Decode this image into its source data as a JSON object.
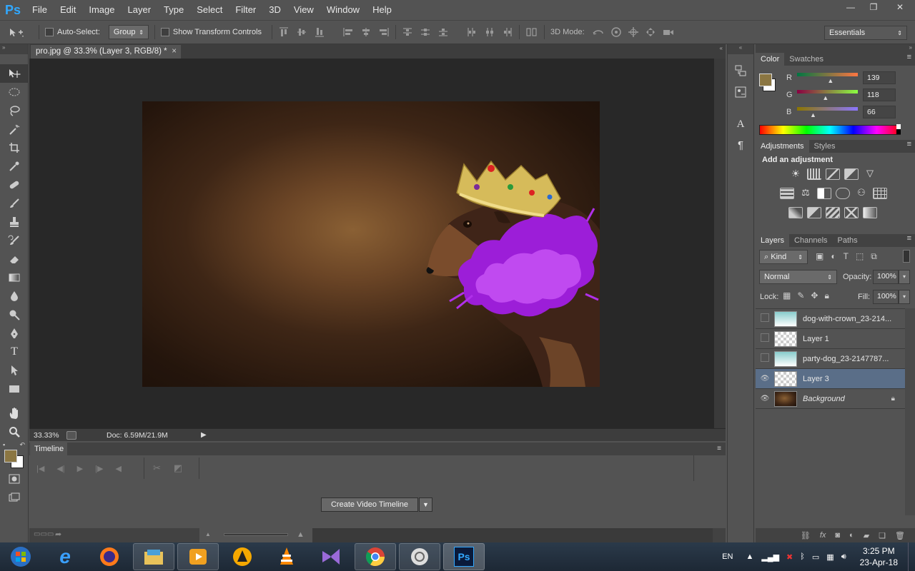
{
  "app": {
    "logo": "Ps"
  },
  "menu": [
    "File",
    "Edit",
    "Image",
    "Layer",
    "Type",
    "Select",
    "Filter",
    "3D",
    "View",
    "Window",
    "Help"
  ],
  "window_controls": {
    "minimize": "—",
    "restore": "❐",
    "close": "✕"
  },
  "options_bar": {
    "auto_select_label": "Auto-Select:",
    "auto_select_checked": false,
    "auto_select_target": "Group",
    "show_transform_label": "Show Transform Controls",
    "show_transform_checked": false,
    "mode_3d_label": "3D Mode:",
    "workspace": "Essentials"
  },
  "document": {
    "tab_title": "pro.jpg @ 33.3% (Layer 3, RGB/8) *",
    "tab_close": "×",
    "zoom": "33.33%",
    "doc_info": "Doc: 6.59M/21.9M"
  },
  "timeline": {
    "tab": "Timeline",
    "create_button": "Create Video Timeline"
  },
  "color_panel": {
    "tabs": [
      "Color",
      "Swatches"
    ],
    "foreground_color": "#8b7642",
    "channels": [
      {
        "label": "R",
        "value": "139",
        "fraction": 0.545
      },
      {
        "label": "G",
        "value": "118",
        "fraction": 0.463
      },
      {
        "label": "B",
        "value": "66",
        "fraction": 0.259
      }
    ]
  },
  "adjustments_panel": {
    "tabs": [
      "Adjustments",
      "Styles"
    ],
    "heading": "Add an adjustment"
  },
  "layers_panel": {
    "tabs": [
      "Layers",
      "Channels",
      "Paths"
    ],
    "filter_kind": "Kind",
    "blend_mode": "Normal",
    "opacity_label": "Opacity:",
    "opacity": "100%",
    "lock_label": "Lock:",
    "fill_label": "Fill:",
    "fill": "100%",
    "layers": [
      {
        "name": "dog-with-crown_23-214...",
        "visible": false,
        "selected": false
      },
      {
        "name": "Layer 1",
        "visible": false,
        "selected": false
      },
      {
        "name": "party-dog_23-2147787...",
        "visible": false,
        "selected": false
      },
      {
        "name": "Layer 3",
        "visible": true,
        "selected": true
      },
      {
        "name": "Background",
        "visible": true,
        "selected": false,
        "locked": true
      }
    ]
  },
  "taskbar": {
    "language": "EN",
    "time": "3:25 PM",
    "date": "23-Apr-18",
    "apps": [
      "windows-start",
      "internet-explorer",
      "firefox",
      "file-explorer",
      "media-player",
      "aimp",
      "vlc",
      "visual-studio",
      "chrome",
      "unknown-app",
      "photoshop"
    ]
  }
}
